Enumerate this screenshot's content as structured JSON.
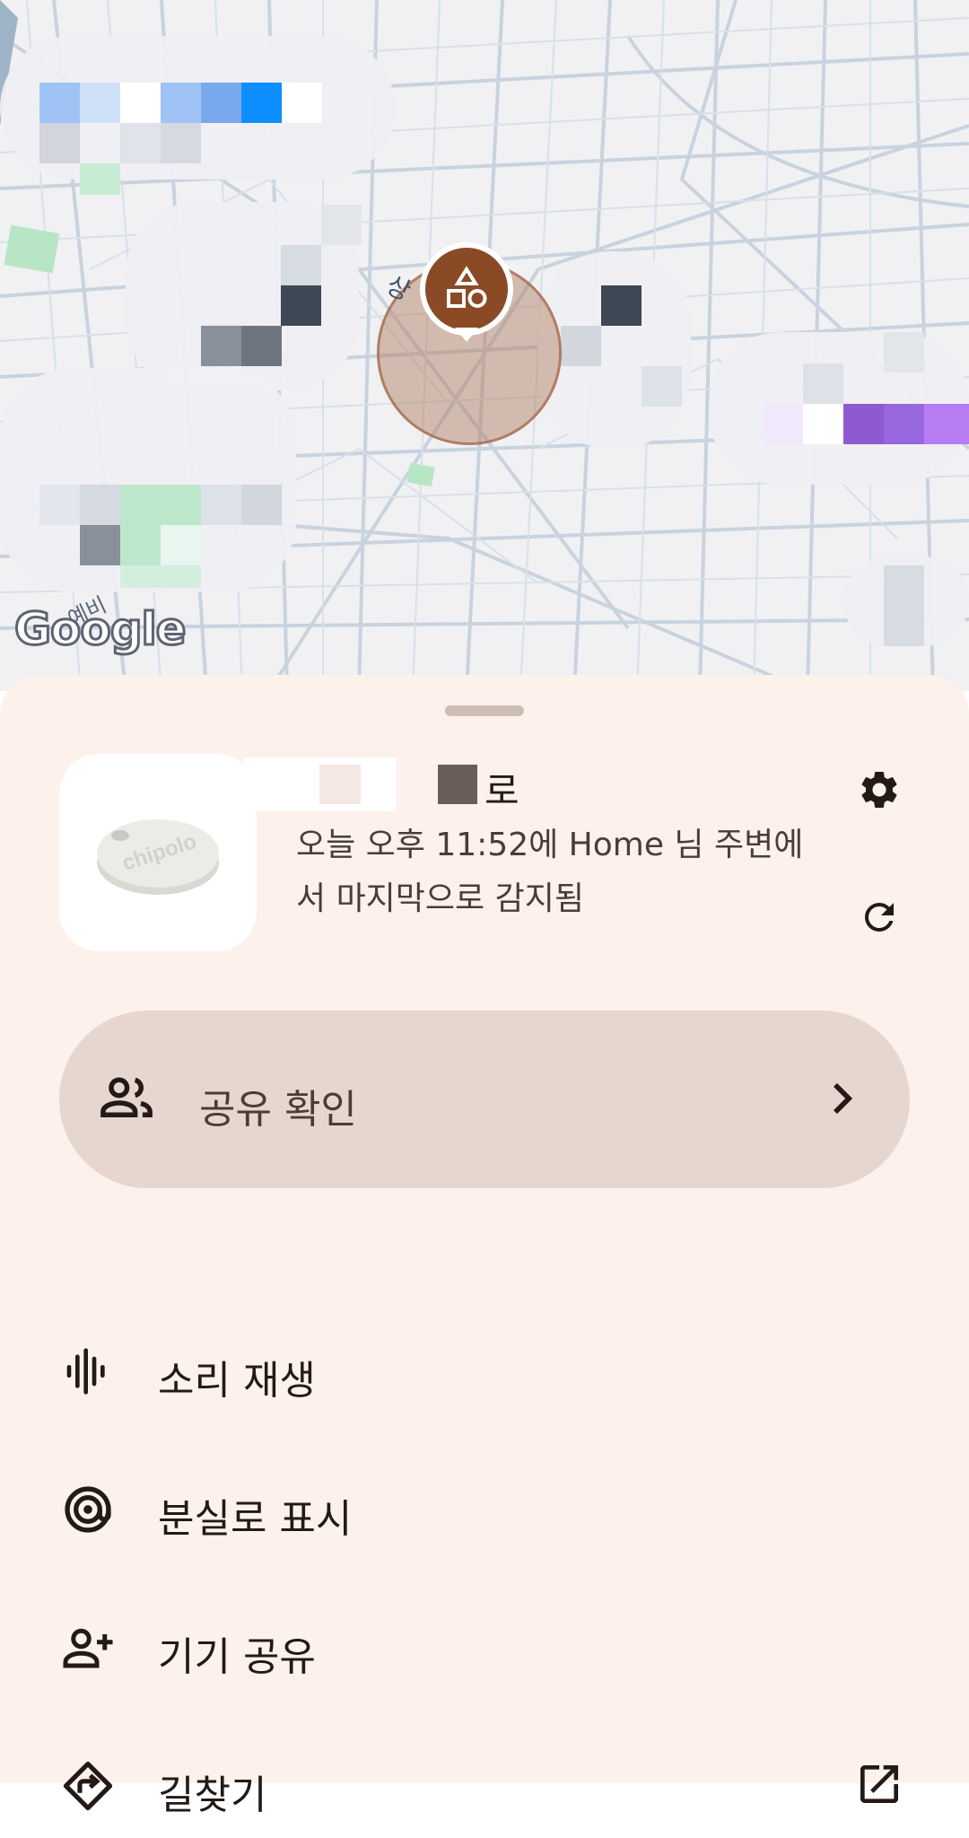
{
  "map": {
    "road_label": "상",
    "area_label": "예비",
    "google_logo": "Google",
    "marker_icon": "shapes-icon",
    "accent_color": "#8b4a26"
  },
  "device": {
    "image_text": "chipolo",
    "name": "로",
    "last_seen": "오늘 오후 11:52에 Home 님 주변에서 마지막으로 감지됨"
  },
  "share_check": {
    "label": "공유 확인",
    "icon": "people-icon"
  },
  "actions": [
    {
      "label": "소리 재생",
      "icon": "sound-wave-icon"
    },
    {
      "label": "분실로 표시",
      "icon": "at-target-icon"
    },
    {
      "label": "기기 공유",
      "icon": "add-person-icon"
    },
    {
      "label": "길찾기",
      "icon": "directions-icon",
      "trailing_icon": "open-external-icon"
    }
  ]
}
